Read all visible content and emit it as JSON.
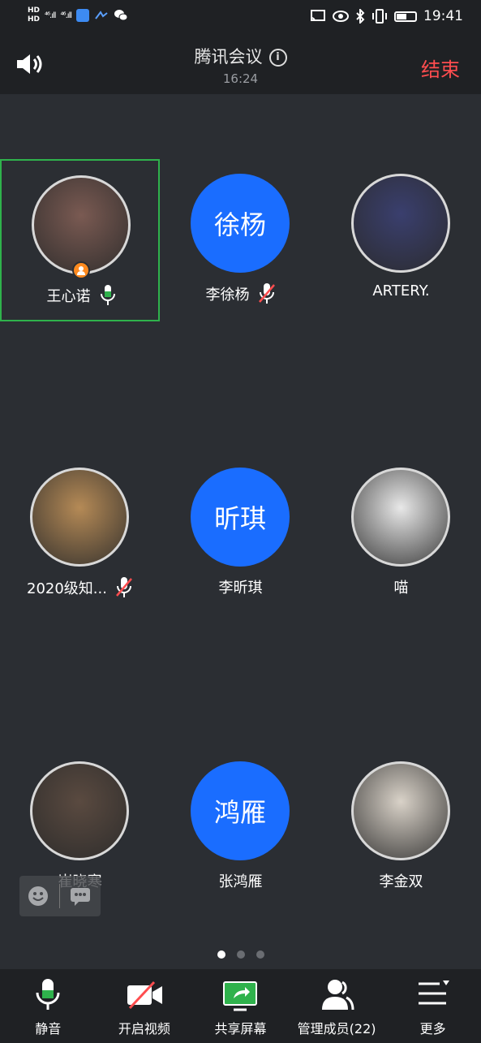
{
  "status_bar": {
    "hd1": "HD",
    "hd2": "HD",
    "sig1": "⁴⁶.ıll",
    "sig2": "⁴⁶.ıll",
    "time": "19:41",
    "battery_level": 0.55
  },
  "header": {
    "title": "腾讯会议",
    "timer": "16:24",
    "end_label": "结束"
  },
  "participants": [
    {
      "name": "王心诺",
      "avatar_text": "",
      "mic": "on",
      "host": true,
      "active": true,
      "avatar_color": "#7a5a52"
    },
    {
      "name": "李徐杨",
      "avatar_text": "徐杨",
      "mic": "muted",
      "host": false,
      "active": false
    },
    {
      "name": "ARTERY.",
      "avatar_text": "",
      "mic": "none",
      "host": false,
      "active": false,
      "avatar_color": "#3a3f6e"
    },
    {
      "name": "2020级知...",
      "avatar_text": "",
      "mic": "muted",
      "host": false,
      "active": false,
      "avatar_color": "#b58a56"
    },
    {
      "name": "李昕琪",
      "avatar_text": "昕琪",
      "mic": "none",
      "host": false,
      "active": false
    },
    {
      "name": "喵",
      "avatar_text": "",
      "mic": "none",
      "host": false,
      "active": false,
      "avatar_color": "#e8e8e8"
    },
    {
      "name": "崔晓寒",
      "avatar_text": "",
      "mic": "none",
      "host": false,
      "active": false,
      "avatar_color": "#5a4a40"
    },
    {
      "name": "张鸿雁",
      "avatar_text": "鸿雁",
      "mic": "none",
      "host": false,
      "active": false
    },
    {
      "name": "李金双",
      "avatar_text": "",
      "mic": "none",
      "host": false,
      "active": false,
      "avatar_color": "#d9d2c8"
    }
  ],
  "pagination": {
    "pages": 3,
    "current": 1
  },
  "toolbar": {
    "mute_label": "静音",
    "video_label": "开启视频",
    "share_label": "共享屏幕",
    "members_label": "管理成员(22)",
    "more_label": "更多"
  },
  "colors": {
    "accent": "#1a6dff",
    "end": "#ff4d4f",
    "active_border": "#2fb24c",
    "mic_on": "#2fb24c",
    "muted": "#ff4d4f"
  }
}
